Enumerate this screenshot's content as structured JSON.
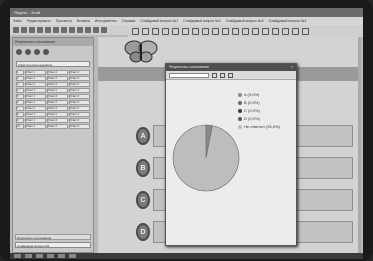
{
  "window": {
    "title": "Яндекс - Знай"
  },
  "menu": [
    "Файл",
    "Редактировать",
    "Просмотр",
    "Вставка",
    "Инструменты",
    "Справка",
    "Слайдовый вопрос №1",
    "Слайдовый вопрос №2",
    "Слайдовый вопрос №3",
    "Слайдовый вопрос №4"
  ],
  "left_pane": {
    "header": "Результаты голосования",
    "field": "Class tree level questions",
    "grid_rows": [
      [
        "1",
        "Ответ 1",
        "Ответ 2",
        "Ответ 3"
      ],
      [
        "2",
        "Ответ 1",
        "Ответ 2",
        "Ответ 3"
      ],
      [
        "3",
        "Ответ 1",
        "Ответ 2",
        "Ответ 3"
      ],
      [
        "4",
        "Ответ 1",
        "Ответ 2",
        "Ответ 3"
      ],
      [
        "5",
        "Ответ 1",
        "Ответ 2",
        "Ответ 3"
      ],
      [
        "6",
        "Ответ 1",
        "Ответ 2",
        "Ответ 3"
      ],
      [
        "7",
        "Ответ 1",
        "Ответ 2",
        "Ответ 3"
      ],
      [
        "8",
        "Ответ 1",
        "Ответ 2",
        "Ответ 3"
      ],
      [
        "9",
        "Ответ 1",
        "Ответ 2",
        "Ответ 3"
      ],
      [
        "10",
        "Ответ 1",
        "Ответ 2",
        "Ответ 3"
      ]
    ],
    "bottom_field_1": "Результаты голосования",
    "bottom_field_2": "Слайдовый вопрос №1"
  },
  "dialog": {
    "title": "Результаты голосования",
    "close": "×"
  },
  "answers": [
    "A",
    "B",
    "C",
    "D"
  ],
  "chart_data": {
    "type": "pie",
    "slices": [
      {
        "label": "A (3,0%)",
        "value": 3.0,
        "color": "#8a8a8a"
      },
      {
        "label": "B (0,0%)",
        "value": 0.0,
        "color": "#6a6a6a"
      },
      {
        "label": "C (0,0%)",
        "value": 0.0,
        "color": "#3a3a3a"
      },
      {
        "label": "D (0,0%)",
        "value": 0.0,
        "color": "#5a5a5a"
      },
      {
        "label": "Не ответил (93,5%)",
        "value": 93.5,
        "color": "#bdbdbd"
      }
    ]
  }
}
